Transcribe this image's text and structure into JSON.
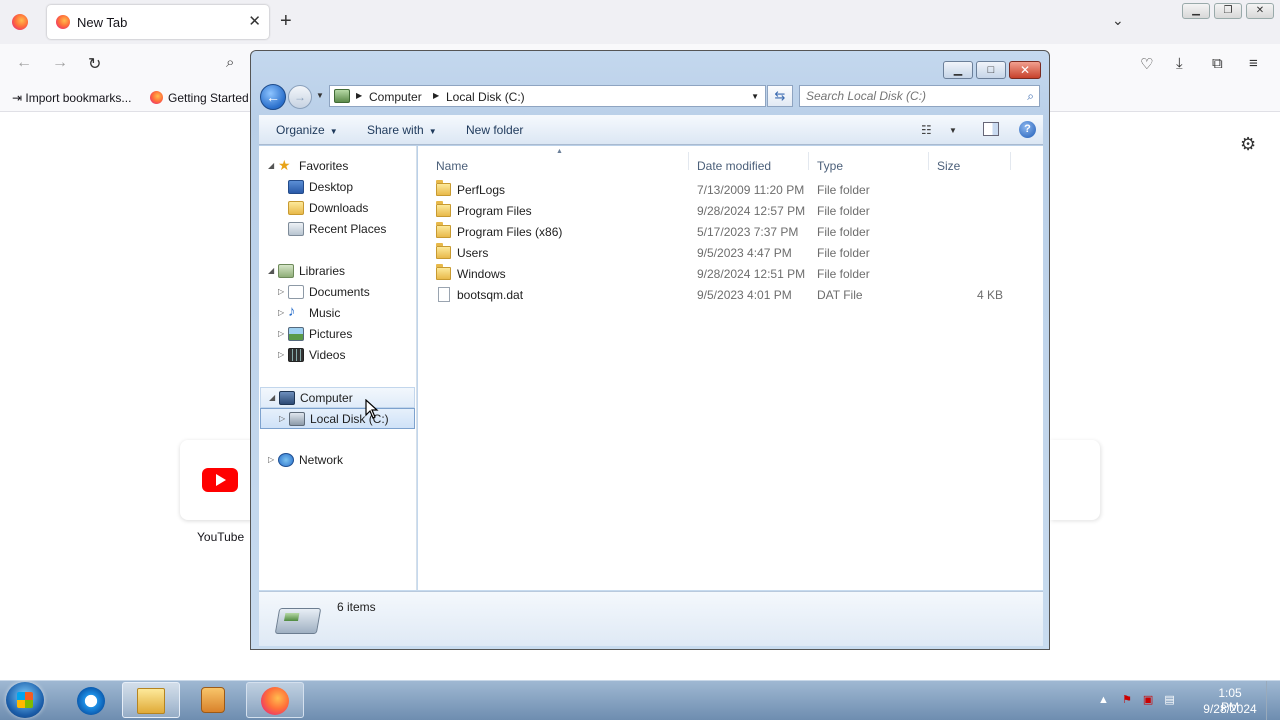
{
  "browser": {
    "tab_title": "New Tab",
    "bookmarks": [
      "Import bookmarks...",
      "Getting Started"
    ],
    "shortcuts": [
      {
        "label": "YouTube"
      }
    ]
  },
  "explorer": {
    "breadcrumb": [
      "Computer",
      "Local Disk (C:)"
    ],
    "search_placeholder": "Search Local Disk (C:)",
    "commands": {
      "organize": "Organize",
      "share_with": "Share with",
      "new_folder": "New folder"
    },
    "nav": {
      "favorites": "Favorites",
      "desktop": "Desktop",
      "downloads": "Downloads",
      "recent_places": "Recent Places",
      "libraries": "Libraries",
      "documents": "Documents",
      "music": "Music",
      "pictures": "Pictures",
      "videos": "Videos",
      "computer": "Computer",
      "local_disk": "Local Disk (C:)",
      "network": "Network"
    },
    "columns": {
      "name": "Name",
      "date_modified": "Date modified",
      "type": "Type",
      "size": "Size"
    },
    "files": [
      {
        "name": "PerfLogs",
        "date": "7/13/2009 11:20 PM",
        "type": "File folder",
        "size": ""
      },
      {
        "name": "Program Files",
        "date": "9/28/2024 12:57 PM",
        "type": "File folder",
        "size": ""
      },
      {
        "name": "Program Files (x86)",
        "date": "5/17/2023 7:37 PM",
        "type": "File folder",
        "size": ""
      },
      {
        "name": "Users",
        "date": "9/5/2023 4:47 PM",
        "type": "File folder",
        "size": ""
      },
      {
        "name": "Windows",
        "date": "9/28/2024 12:51 PM",
        "type": "File folder",
        "size": ""
      },
      {
        "name": "bootsqm.dat",
        "date": "9/5/2023 4:01 PM",
        "type": "DAT File",
        "size": "4 KB"
      }
    ],
    "status": "6 items"
  },
  "taskbar": {
    "time": "1:05 PM",
    "date": "9/28/2024"
  },
  "colors": {
    "accent_blue": "#2a6fcb",
    "close_red": "#c7412c",
    "folder_yellow": "#e8b94a"
  }
}
